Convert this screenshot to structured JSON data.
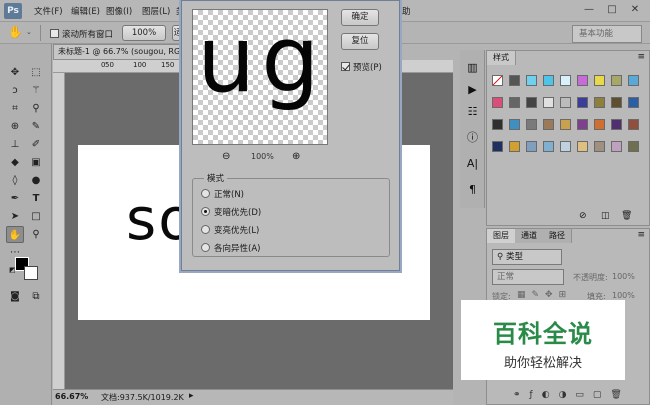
{
  "app": {
    "logo": "Ps"
  },
  "menubar": {
    "items": [
      "文件(F)",
      "编辑(E)",
      "图像(I)",
      "图层(L)",
      "类"
    ],
    "right_item": "助",
    "window_controls": [
      "—",
      "□",
      "✕"
    ]
  },
  "options_bar": {
    "scroll_all_windows_label": "滚动所有窗口",
    "scroll_all_windows_checked": false,
    "zoom_value": "100%",
    "fit_label": "适",
    "workspace": "基本功能"
  },
  "document": {
    "tab_title": "未标题-1 @ 66.7% (sougou, RGB/8",
    "ruler_ticks": [
      "0",
      "50",
      "100",
      "150"
    ],
    "canvas_text": "so",
    "status_zoom": "66.67%",
    "status_doc": "文档:937.5K/1019.2K"
  },
  "dialog": {
    "ok_label": "确定",
    "reset_label": "复位",
    "preview_label": "预览(P)",
    "preview_checked": true,
    "preview_text": "ug",
    "zoom_level": "100%",
    "mode_legend": "模式",
    "modes": [
      {
        "label": "正常(N)",
        "selected": false
      },
      {
        "label": "变暗优先(D)",
        "selected": true
      },
      {
        "label": "变亮优先(L)",
        "selected": false
      },
      {
        "label": "各向异性(A)",
        "selected": false
      }
    ]
  },
  "styles_panel": {
    "tab": "样式",
    "colors": {
      "row1": [
        "#ffffff",
        "#555555",
        "#6fd0ef",
        "#4ec4e8",
        "#d7f2fb",
        "#c76bd9",
        "#e8d84a",
        "#a7a76a",
        "#5aa8d8"
      ],
      "row2": [
        "#d94f7a",
        "#666666",
        "#444444",
        "#e0e0e0",
        "#bcbcbc",
        "#3c3c9a",
        "#8f7f3f",
        "#5f4f2f",
        "#2a5fa5"
      ],
      "row3": [
        "#2f2f2f",
        "#3f8fc0",
        "#7a7a7a",
        "#9a7a5a",
        "#c8a050",
        "#7f3f8f",
        "#d07030",
        "#4f2f6f",
        "#8f4f3f"
      ],
      "row4": [
        "#1f2f5f",
        "#d0a030",
        "#7f9fbf",
        "#7fb0d0",
        "#bfd0e0",
        "#e0c080",
        "#a09080",
        "#c0a0c0",
        "#707050"
      ]
    }
  },
  "layers_panel": {
    "tabs": [
      "图层",
      "通道",
      "路径"
    ],
    "filter_label": "类型",
    "blend_mode": "正常",
    "opacity_label": "不透明度:",
    "opacity_value": "100%",
    "lock_label": "锁定:",
    "fill_label": "填充:",
    "fill_value": "100%"
  },
  "watermark": {
    "title": "百科全说",
    "subtitle": "助你轻松解决"
  }
}
